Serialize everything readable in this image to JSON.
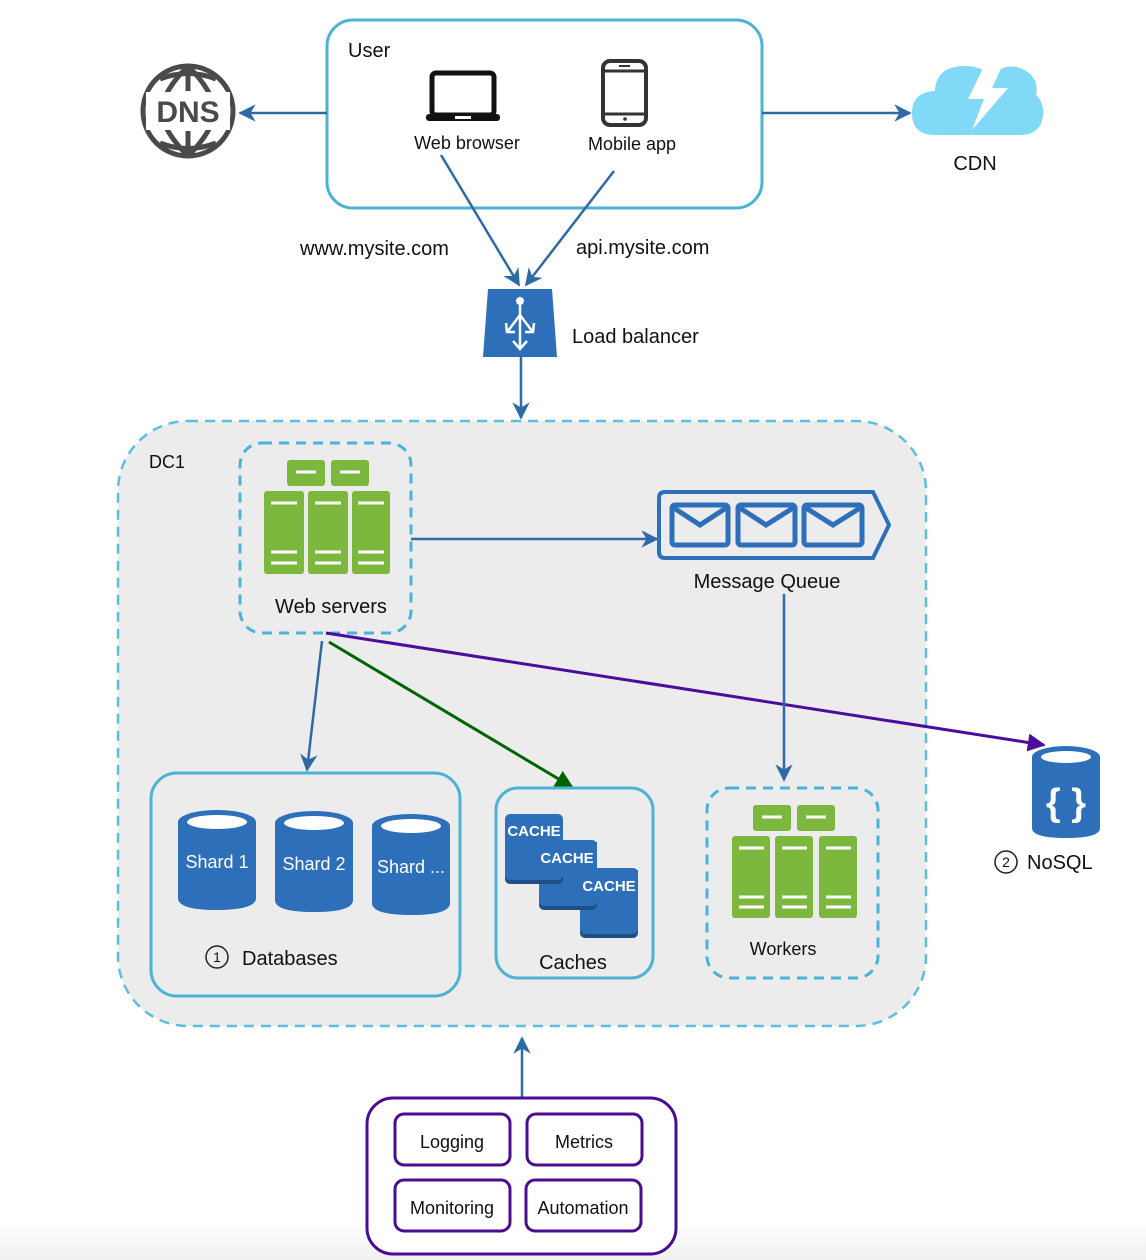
{
  "user_box": {
    "title": "User",
    "clients": [
      {
        "icon": "laptop-icon",
        "label": "Web browser"
      },
      {
        "icon": "mobile-phone-icon",
        "label": "Mobile app"
      }
    ]
  },
  "dns": {
    "icon": "dns-globe-icon",
    "label": "DNS"
  },
  "cdn": {
    "icon": "cdn-cloud-icon",
    "label": "CDN"
  },
  "domains": {
    "web": "www.mysite.com",
    "api": "api.mysite.com"
  },
  "load_balancer": {
    "label": "Load balancer"
  },
  "datacenter": {
    "label": "DC1",
    "web_servers": {
      "label": "Web servers"
    },
    "message_queue": {
      "label": "Message Queue"
    },
    "databases": {
      "number": "1",
      "label": "Databases",
      "shards": [
        "Shard 1",
        "Shard 2",
        "Shard ..."
      ]
    },
    "caches": {
      "label": "Caches",
      "items": [
        "CACHE",
        "CACHE",
        "CACHE"
      ]
    },
    "workers": {
      "label": "Workers"
    }
  },
  "nosql": {
    "number": "2",
    "label": "NoSQL",
    "glyph": "{ }"
  },
  "tools": {
    "items": [
      "Logging",
      "Metrics",
      "Monitoring",
      "Automation"
    ]
  },
  "colors": {
    "arrow_blue": "#2f6aa6",
    "arrow_green": "#006400",
    "arrow_purple": "#4b0d9c",
    "box_cyan": "#4cb3d4",
    "server_green": "#7cb83e",
    "db_blue": "#2e6fba",
    "cdn_cloud": "#7fd9f7"
  }
}
